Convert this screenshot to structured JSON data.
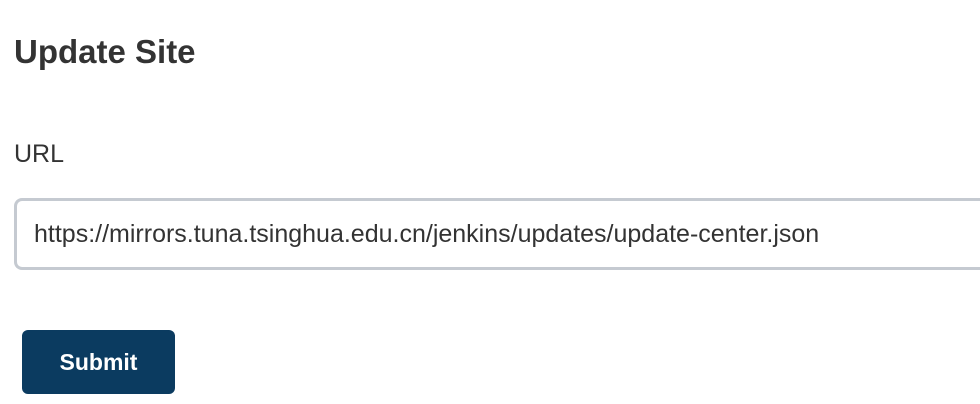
{
  "update_site": {
    "title": "Update Site",
    "url_label": "URL",
    "url_value": "https://mirrors.tuna.tsinghua.edu.cn/jenkins/updates/update-center.json",
    "submit_label": "Submit"
  },
  "colors": {
    "button_background": "#0b3b60",
    "button_text": "#ffffff",
    "input_border": "#c5cad1",
    "text": "#333333"
  }
}
